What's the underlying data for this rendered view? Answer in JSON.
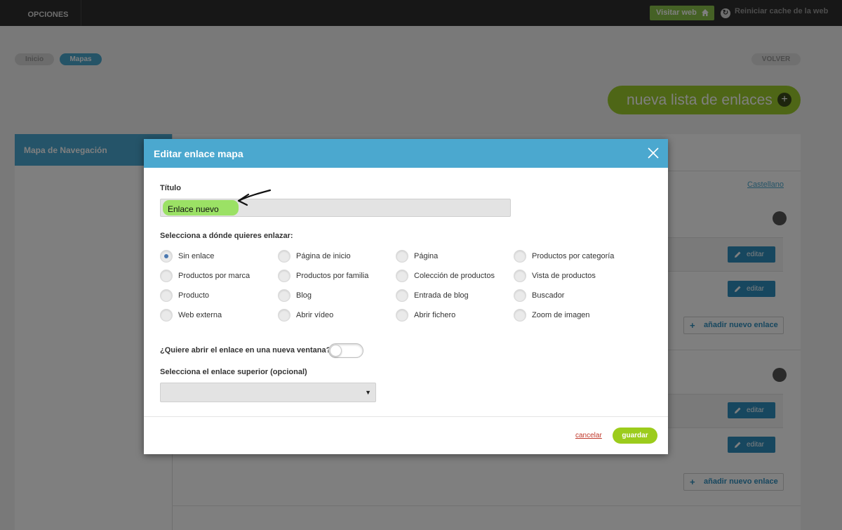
{
  "topbar": {
    "opciones_label": "OPCIONES",
    "visit_label": "Visitar web",
    "reset_label": "Reiniciar cache de la web"
  },
  "breadcrumb": [
    "Inicio",
    "Mapas"
  ],
  "back_label": "VOLVER",
  "new_list_label": "nueva lista de enlaces",
  "sidebar": {
    "title": "Mapa de Navegación"
  },
  "main": {
    "language_link": "Castellano",
    "edit_label": "editar",
    "add_link_label": "añadir nuevo enlace"
  },
  "modal": {
    "title": "Editar enlace mapa",
    "title_label": "Título",
    "title_value": "Enlace nuevo",
    "link_target_label": "Selecciona a dónde quieres enlazar:",
    "options": [
      "Sin enlace",
      "Página de inicio",
      "Página",
      "Productos por categoría",
      "Productos por marca",
      "Productos por familia",
      "Colección de productos",
      "Vista de productos",
      "Producto",
      "Blog",
      "Entrada de blog",
      "Buscador",
      "Web externa",
      "Abrir vídeo",
      "Abrir fichero",
      "Zoom de imagen"
    ],
    "selected_option": "Sin enlace",
    "new_window_label": "¿Quiere abrir el enlace en una nueva ventana?",
    "new_window_enabled": false,
    "parent_link_label": "Selecciona el enlace superior (opcional)",
    "parent_link_value": "",
    "cancel_label": "cancelar",
    "save_label": "guardar"
  },
  "colors": {
    "topbar": "#2f2f2f",
    "accent_blue": "#4ba8cf",
    "accent_green": "#9ccc1c",
    "edit_button": "#2f8fbf",
    "cancel_red": "#c0392b"
  }
}
